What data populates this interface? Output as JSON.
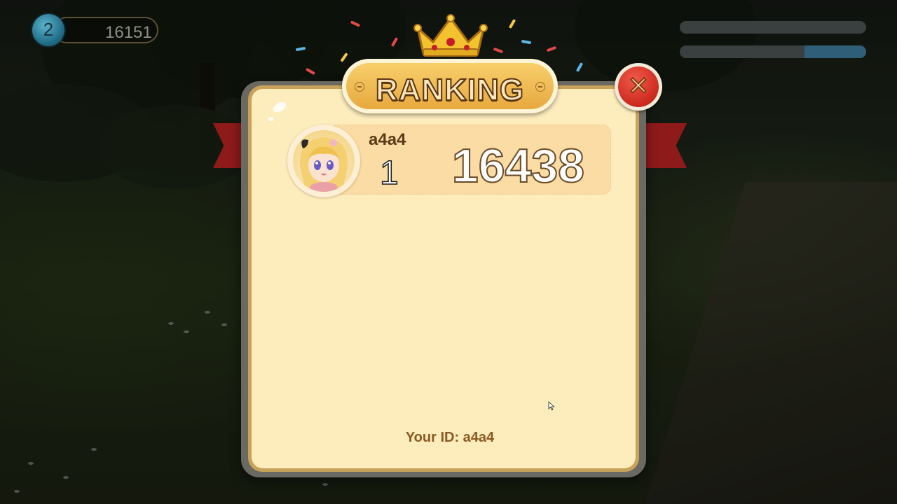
{
  "hud": {
    "level": "2",
    "score": "16151",
    "progress_bars": [
      {
        "fill_fraction": 0.0
      },
      {
        "fill_fraction": 0.33
      }
    ]
  },
  "ranking_panel": {
    "title": "RANKING",
    "close_icon": "close-x-icon",
    "entries": [
      {
        "rank": "1",
        "name": "a4a4",
        "score": "16438",
        "avatar_icon": "anime-girl-avatar"
      }
    ],
    "your_id": "Your ID: a4a4"
  },
  "colors": {
    "panel_paper": "#fdecbc",
    "title_plate": "#e7a83e",
    "close_button": "#cc2a1e",
    "ribbon": "#8e1a1a",
    "level_badge": "#1f6b85"
  }
}
